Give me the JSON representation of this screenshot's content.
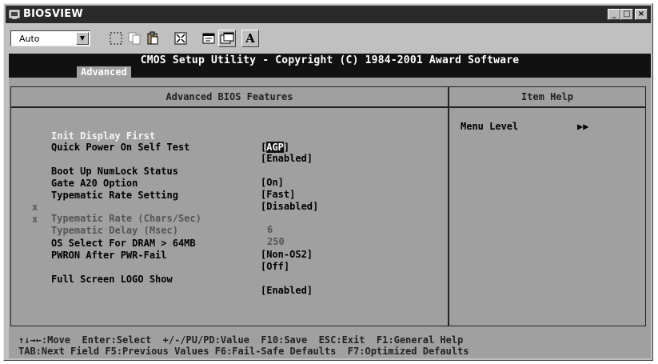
{
  "window": {
    "title": "BIOSVIEW",
    "buttons": [
      "_",
      "□",
      "×"
    ]
  },
  "toolbar": {
    "font_combo_value": "Auto",
    "text_button_label": "A"
  },
  "bios": {
    "header_title": "CMOS Setup Utility - Copyright (C) 1984-2001 Award Software",
    "active_tab": "Advanced",
    "panel_title": "Advanced BIOS Features",
    "help_title": "Item Help",
    "help_menu_level_label": "Menu Level",
    "help_menu_level_value": "▶▶",
    "items": [
      {
        "label": "Init Display First",
        "value_open": "[",
        "value_hl": "AGP",
        "value_close": "]"
      },
      {
        "label": "Quick Power On Self Test",
        "value": "[Enabled]"
      },
      {
        "label": "Boot Up NumLock Status",
        "value": "[On]"
      },
      {
        "label": "Gate A20 Option",
        "value": "[Fast]"
      },
      {
        "label": "Typematic Rate Setting",
        "value": "[Disabled]"
      },
      {
        "label": "Typematic Rate (Chars/Sec)",
        "value": "6",
        "mark": "x"
      },
      {
        "label": "Typematic Delay (Msec)",
        "value": "250",
        "mark": "x"
      },
      {
        "label": "OS Select For DRAM > 64MB",
        "value": "[Non-OS2]"
      },
      {
        "label": "PWRON After PWR-Fail",
        "value": "[Off]"
      },
      {
        "label": "Full Screen LOGO Show",
        "value": "[Enabled]"
      }
    ],
    "footer_line1": "↑↓→←:Move  Enter:Select  +/-/PU/PD:Value  F10:Save  ESC:Exit  F1:General Help",
    "footer_line2": "TAB:Next Field F5:Previous Values F6:Fail-Safe Defaults  F7:Optimized Defaults"
  },
  "colors": {
    "title_bar": "#2a2a2a",
    "screen_bg": "#a0a0a0",
    "chrome": "#c0c0c0"
  }
}
